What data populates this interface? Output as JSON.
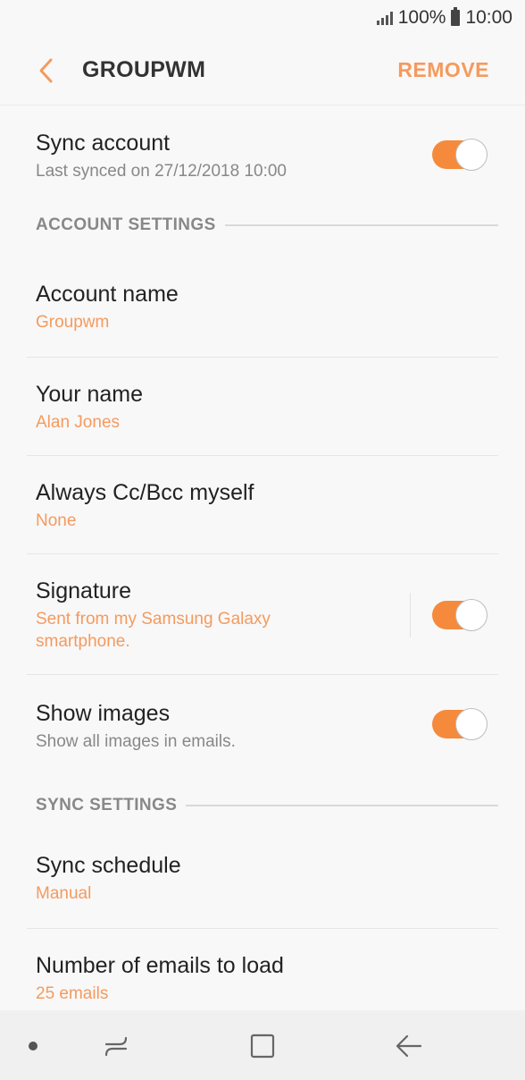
{
  "status_bar": {
    "battery": "100%",
    "time": "10:00"
  },
  "app_bar": {
    "title": "GROUPWM",
    "remove_label": "REMOVE"
  },
  "sync_account": {
    "title": "Sync account",
    "subtitle": "Last synced on 27/12/2018  10:00",
    "enabled": true
  },
  "account_settings": {
    "header": "ACCOUNT SETTINGS",
    "account_name": {
      "title": "Account name",
      "value": "Groupwm"
    },
    "your_name": {
      "title": "Your name",
      "value": "Alan Jones"
    },
    "cc_bcc": {
      "title": "Always Cc/Bcc myself",
      "value": "None"
    },
    "signature": {
      "title": "Signature",
      "value_line1": "Sent from my Samsung Galaxy",
      "value_line2": "smartphone.",
      "enabled": true
    },
    "show_images": {
      "title": "Show images",
      "subtitle": "Show all images in emails.",
      "enabled": true
    }
  },
  "sync_settings": {
    "header": "SYNC SETTINGS",
    "sync_schedule": {
      "title": "Sync schedule",
      "value": "Manual"
    },
    "emails_to_load": {
      "title": "Number of emails to load",
      "value": "25 emails"
    }
  },
  "colors": {
    "accent": "#f59a5e",
    "toggle_on": "#f58a3c"
  },
  "icons": {
    "back": "chevron-left-icon",
    "recent": "recent-apps-icon",
    "home": "home-icon",
    "nav_back": "back-arrow-icon"
  }
}
